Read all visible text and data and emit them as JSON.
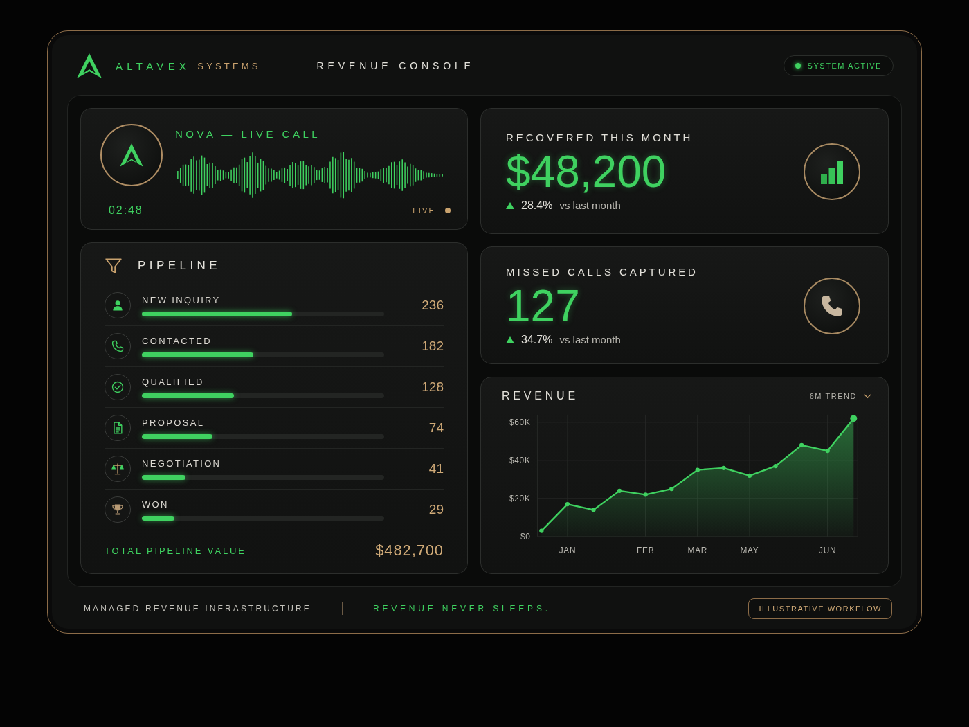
{
  "header": {
    "brand_name": "ALTAVEX",
    "brand_suffix": "SYSTEMS",
    "console_title": "REVENUE CONSOLE",
    "status": {
      "label": "SYSTEM ACTIVE",
      "active": true
    }
  },
  "live_call": {
    "title": "NOVA — LIVE CALL",
    "timer": "02:48",
    "live_label": "LIVE"
  },
  "pipeline": {
    "title": "PIPELINE",
    "stages": [
      {
        "label": "NEW INQUIRY",
        "count": "236",
        "level": 0.62
      },
      {
        "label": "CONTACTED",
        "count": "182",
        "level": 0.46
      },
      {
        "label": "QUALIFIED",
        "count": "128",
        "level": 0.38
      },
      {
        "label": "PROPOSAL",
        "count": "74",
        "level": 0.29
      },
      {
        "label": "NEGOTIATION",
        "count": "41",
        "level": 0.18
      },
      {
        "label": "WON",
        "count": "29",
        "level": 0.135
      }
    ],
    "total_label": "TOTAL PIPELINE VALUE",
    "total_value": "$482,700"
  },
  "metrics": [
    {
      "title": "RECOVERED THIS MONTH",
      "value": "$48,200",
      "increase": true,
      "change": "28.4%",
      "comparison": "vs last month"
    },
    {
      "title": "MISSED CALLS CAPTURED",
      "value": "127",
      "increase": true,
      "change": "34.7%",
      "comparison": "vs last month"
    }
  ],
  "revenue": {
    "range_selector": "6M TREND",
    "chart_data": {
      "type": "area",
      "title": "REVENUE",
      "categories": [
        null,
        "JAN",
        null,
        null,
        "FEB",
        null,
        "MAR",
        null,
        "MAY",
        null,
        null,
        "JUN",
        null
      ],
      "series": [
        {
          "color": "#3fd160",
          "values": [
            3,
            17,
            14,
            24,
            22,
            25,
            35,
            36,
            32,
            37,
            48,
            45,
            62
          ]
        }
      ],
      "ylim": [
        0,
        64
      ],
      "yticks": [
        {
          "value": 0,
          "label": "$0"
        },
        {
          "value": 20,
          "label": "$20K"
        },
        {
          "value": 40,
          "label": "$40K"
        },
        {
          "value": 60,
          "label": "$60K"
        }
      ],
      "grid": true
    }
  },
  "footer": {
    "tagline": "MANAGED REVENUE INFRASTRUCTURE",
    "motto": "REVENUE NEVER SLEEPS.",
    "badge": "ILLUSTRATIVE WORKFLOW"
  }
}
